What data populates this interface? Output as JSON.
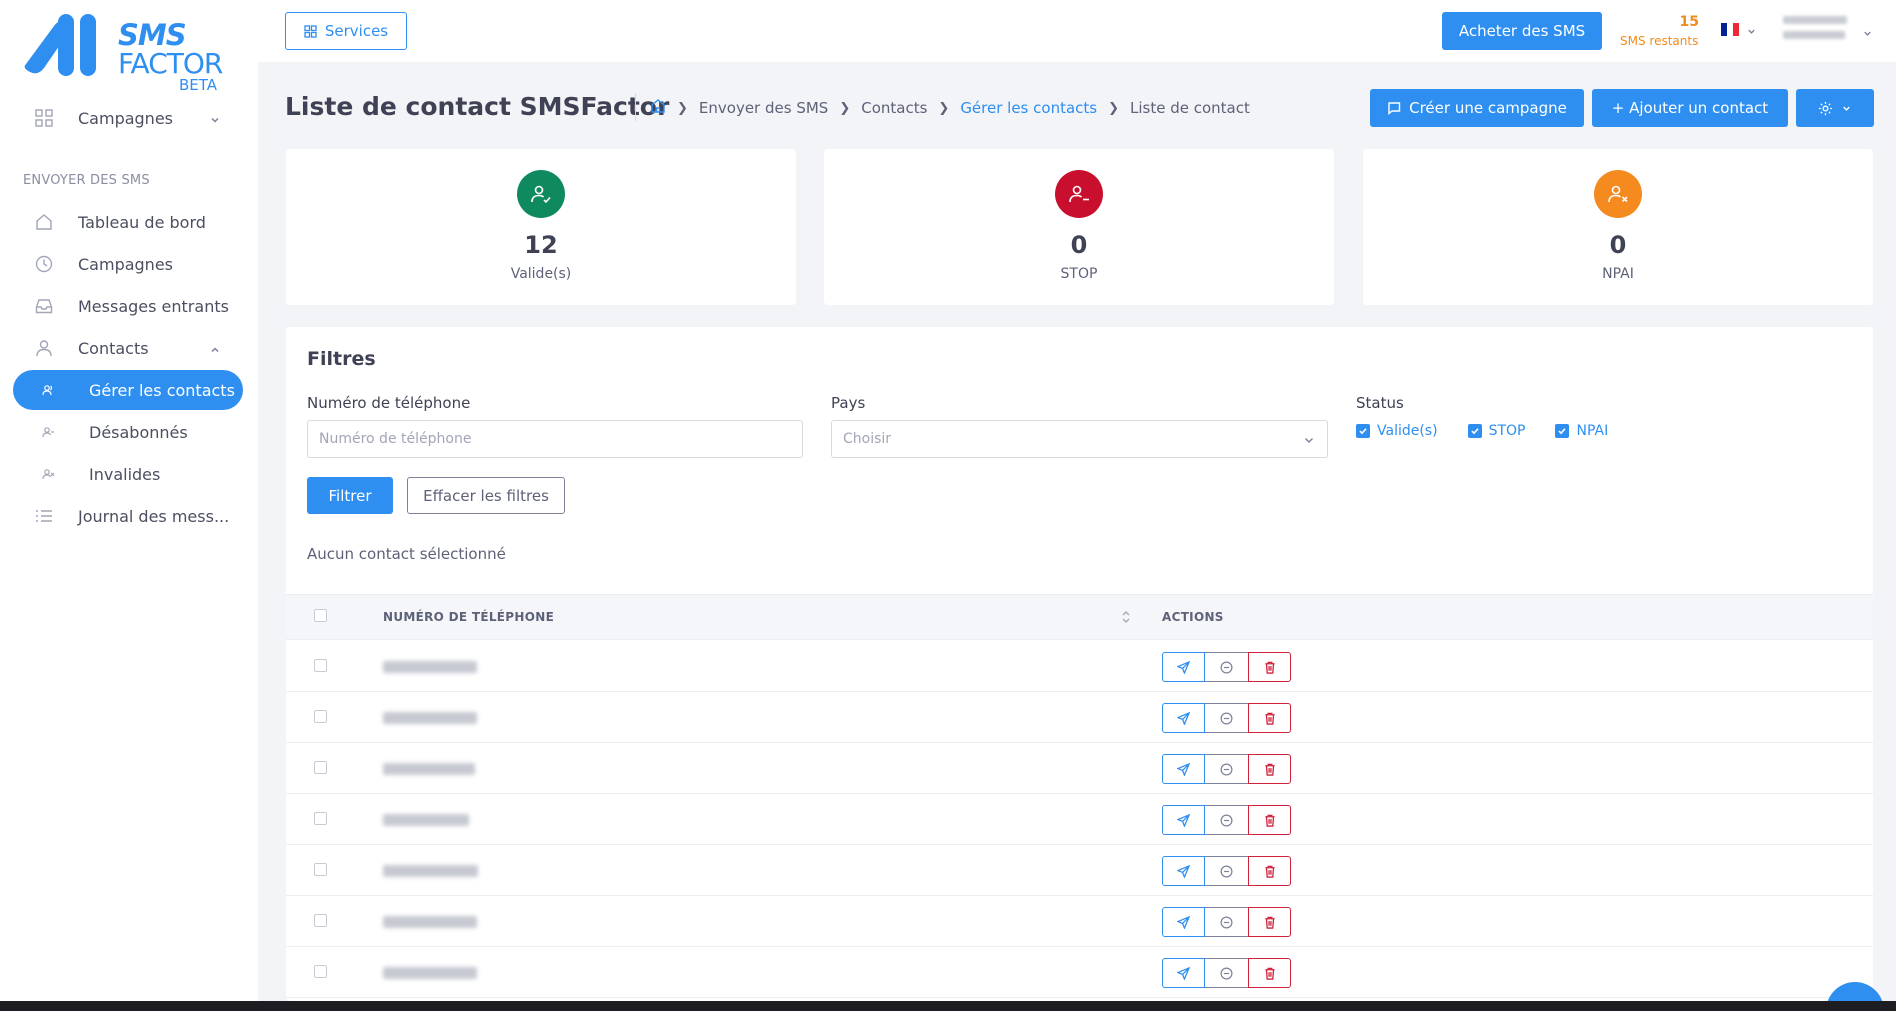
{
  "logo": {
    "line1": "SMS",
    "line2": "FACTOR",
    "badge": "BETA"
  },
  "sidebar": {
    "section_label": "ENVOYER DES SMS",
    "top_item": {
      "label": "Campagnes",
      "icon": "grid-icon"
    },
    "items": [
      {
        "label": "Tableau de bord",
        "icon": "home-icon"
      },
      {
        "label": "Campagnes",
        "icon": "clock-icon"
      },
      {
        "label": "Messages entrants",
        "icon": "inbox-icon"
      },
      {
        "label": "Contacts",
        "icon": "user-icon"
      },
      {
        "label": "Gérer les contacts",
        "icon": "users-icon"
      },
      {
        "label": "Désabonnés",
        "icon": "user-minus-icon"
      },
      {
        "label": "Invalides",
        "icon": "user-x-icon"
      },
      {
        "label": "Journal des mess...",
        "icon": "list-icon"
      }
    ]
  },
  "topbar": {
    "services_label": "Services",
    "buy_label": "Acheter des SMS",
    "sms_count": "15",
    "sms_count_label": "SMS restants",
    "flag_colors": [
      "#002395",
      "#ffffff",
      "#ed2939"
    ]
  },
  "header": {
    "title": "Liste de contact SMSFactor",
    "breadcrumb": [
      "Envoyer des SMS",
      "Contacts",
      "Gérer les contacts",
      "Liste de contact"
    ],
    "create_campaign_label": "Créer une campagne",
    "add_contact_label": "+ Ajouter un contact"
  },
  "stats": [
    {
      "value": "12",
      "label": "Valide(s)",
      "color": "#0f8a5f"
    },
    {
      "value": "0",
      "label": "STOP",
      "color": "#c8102e"
    },
    {
      "value": "0",
      "label": "NPAI",
      "color": "#f58a1f"
    }
  ],
  "filters": {
    "title": "Filtres",
    "phone_label": "Numéro de téléphone",
    "phone_placeholder": "Numéro de téléphone",
    "country_label": "Pays",
    "country_placeholder": "Choisir",
    "status_label": "Status",
    "status_options": [
      "Valide(s)",
      "STOP",
      "NPAI"
    ],
    "filter_button": "Filtrer",
    "clear_button": "Effacer les filtres",
    "selection_info": "Aucun contact sélectionné"
  },
  "table": {
    "col_phone": "NUMÉRO DE TÉLÉPHONE",
    "col_actions": "ACTIONS",
    "rows_visible": 7
  },
  "colors": {
    "accent": "#2e8ff0",
    "danger": "#d0213a",
    "warning": "#f08c1d"
  }
}
